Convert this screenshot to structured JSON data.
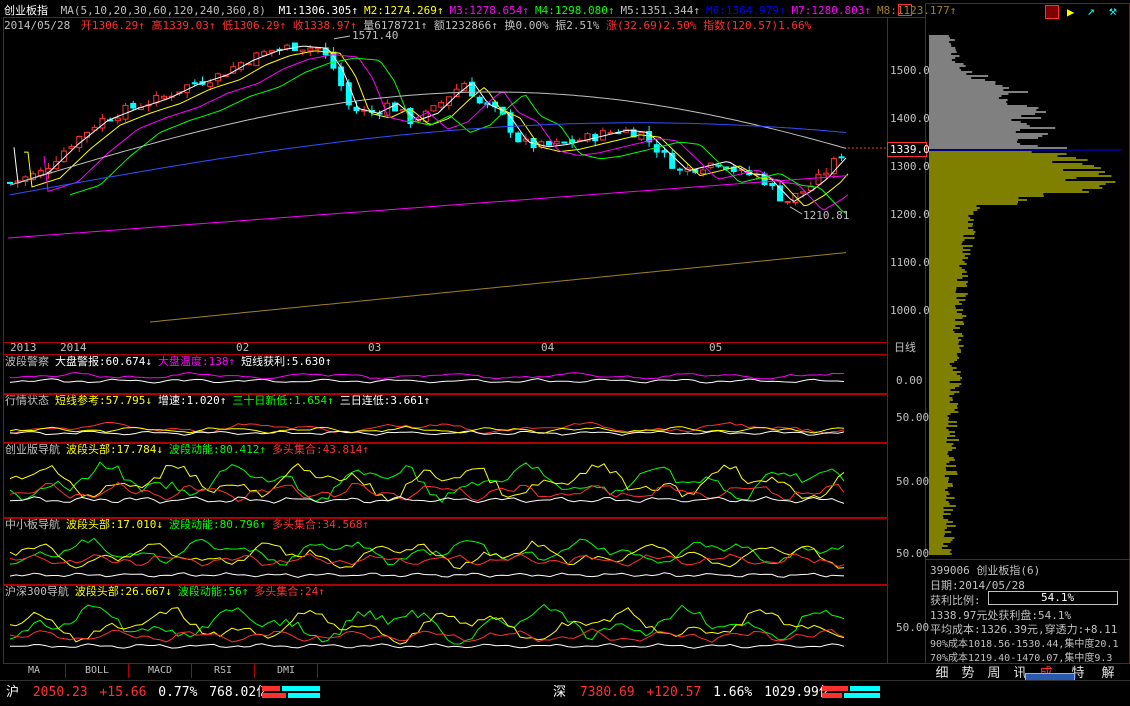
{
  "header": {
    "name": "创业板指",
    "ma_params": "MA(5,10,20,30,60,120,240,360,8)",
    "ma": [
      {
        "label": "M1:1306.305",
        "color": "#ffffff"
      },
      {
        "label": "M2:1274.269",
        "color": "#ffff00"
      },
      {
        "label": "M3:1278.654",
        "color": "#ff00ff"
      },
      {
        "label": "M4:1298.080",
        "color": "#00ff00"
      },
      {
        "label": "M5:1351.344",
        "color": "#c0c0c0"
      },
      {
        "label": "M6:1364.979",
        "color": "#0000ff"
      },
      {
        "label": "M7:1280.803",
        "color": "#ff00ff"
      },
      {
        "label": "M8:1123.177",
        "color": "#a08020"
      }
    ],
    "date": "2014/05/28",
    "open": "开1306.29",
    "high": "高1339.03",
    "low": "低1306.29",
    "close": "收1338.97",
    "volume": "量6178721",
    "amount": "额1232866",
    "turnover": "换0.00%",
    "amplitude": "振2.51%",
    "change": "涨(32.69)2.50%",
    "index": "指数(120.57)1.66%"
  },
  "main_chart": {
    "high_label": "1571.40",
    "low_label": "1210.81",
    "current_price": "1339.0",
    "price_ticks": [
      "1500.0",
      "1400.0",
      "1300.0",
      "1200.0",
      "1100.0",
      "1000.0"
    ],
    "x_labels": [
      "2013",
      "2014",
      "02",
      "03",
      "04",
      "05"
    ],
    "period": "日线"
  },
  "panels": [
    {
      "title": "波段警察",
      "items": [
        {
          "t": "大盘警报:60.674",
          "c": "#ffffff"
        },
        {
          "t": "大盘温度:138",
          "c": "#ff00ff"
        },
        {
          "t": "短线获利:5.630",
          "c": "#ffffff"
        }
      ],
      "tick": "0.00"
    },
    {
      "title": "行情状态",
      "items": [
        {
          "t": "短线参考:57.795",
          "c": "#ffff00"
        },
        {
          "t": "增速:1.020",
          "c": "#ffffff"
        },
        {
          "t": "三十日新低:1.654",
          "c": "#00ff00"
        },
        {
          "t": "三日连低:3.661",
          "c": "#ffffff"
        }
      ],
      "tick": "50.00"
    },
    {
      "title": "创业版导航",
      "items": [
        {
          "t": "波段头部:17.784",
          "c": "#ffff00"
        },
        {
          "t": "波段动能:80.412",
          "c": "#00ff00"
        },
        {
          "t": "多头集合:43.814",
          "c": "#ff3030"
        }
      ],
      "tick": "50.00"
    },
    {
      "title": "中小板导航",
      "items": [
        {
          "t": "波段头部:17.010",
          "c": "#ffff00"
        },
        {
          "t": "波段动能:80.796",
          "c": "#00ff00"
        },
        {
          "t": "多头集合:34.568",
          "c": "#ff3030"
        }
      ],
      "tick": "50.00"
    },
    {
      "title": "沪深300导航",
      "items": [
        {
          "t": "波段头部:26.667",
          "c": "#ffff00"
        },
        {
          "t": "波段动能:56",
          "c": "#00ff00"
        },
        {
          "t": "多头集合:24",
          "c": "#ff3030"
        }
      ],
      "tick": "50.00"
    }
  ],
  "bottom_tabs": [
    "MA",
    "BOLL",
    "MACD",
    "RSI",
    "DMI"
  ],
  "side_info": {
    "code_name": "399006 创业板指(6)",
    "date": "日期:2014/05/28",
    "profit_label": "获利比例:",
    "profit_value": "54.1%",
    "line1": "1338.97元处获利盘:54.1%",
    "line2": "平均成本:1326.39元,穿透力:+8.11",
    "line3": "90%成本1018.56-1530.44,集中度20.1",
    "line4": "70%成本1219.40-1470.07,集中度9.3"
  },
  "side_tabs": [
    "细",
    "势",
    "周",
    "讯",
    "成",
    "特",
    "解"
  ],
  "status_bar": {
    "sh_label": "沪",
    "sh_price": "2050.23",
    "sh_change": "+15.66",
    "sh_pct": "0.77%",
    "sh_amount": "768.02亿",
    "sz_label": "深",
    "sz_price": "7380.69",
    "sz_change": "+120.57",
    "sz_pct": "1.66%",
    "sz_amount": "1029.99亿"
  },
  "colors": {
    "up": "#ff3030",
    "down": "#00ffff",
    "frame": "#b00000"
  }
}
